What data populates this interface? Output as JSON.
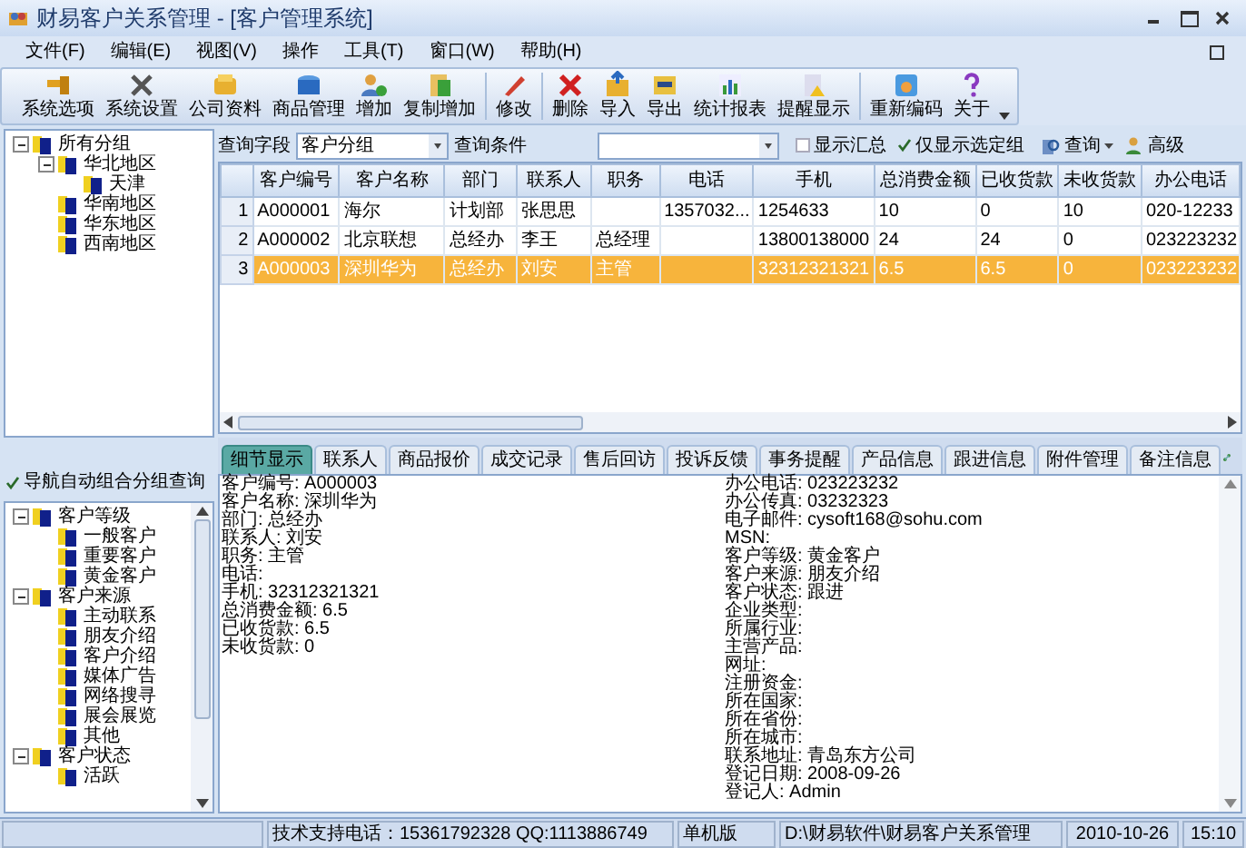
{
  "window": {
    "title": "财易客户关系管理 - [客户管理系统]"
  },
  "menu": [
    "文件(F)",
    "编辑(E)",
    "视图(V)",
    "操作",
    "工具(T)",
    "窗口(W)",
    "帮助(H)"
  ],
  "toolbar": [
    {
      "label": "系统选项"
    },
    {
      "label": "系统设置"
    },
    {
      "label": "公司资料"
    },
    {
      "label": "商品管理"
    },
    {
      "label": "增加"
    },
    {
      "label": "复制增加"
    },
    {
      "label": "修改"
    },
    {
      "label": "删除"
    },
    {
      "label": "导入"
    },
    {
      "label": "导出"
    },
    {
      "label": "统计报表"
    },
    {
      "label": "提醒显示"
    },
    {
      "label": "重新编码"
    },
    {
      "label": "关于"
    }
  ],
  "group_tree": [
    {
      "label": "所有分组",
      "expanded": true,
      "children": [
        {
          "label": "华北地区",
          "expanded": true,
          "children": [
            {
              "label": "天津"
            }
          ]
        },
        {
          "label": "华南地区"
        },
        {
          "label": "华东地区"
        },
        {
          "label": "西南地区"
        }
      ]
    }
  ],
  "nav_option": {
    "label": "导航自动组合分组查询",
    "checked": true
  },
  "nav_tree": [
    {
      "label": "客户等级",
      "expanded": true,
      "children": [
        {
          "label": "一般客户"
        },
        {
          "label": "重要客户"
        },
        {
          "label": "黄金客户"
        }
      ]
    },
    {
      "label": "客户来源",
      "expanded": true,
      "children": [
        {
          "label": "主动联系"
        },
        {
          "label": "朋友介绍"
        },
        {
          "label": "客户介绍"
        },
        {
          "label": "媒体广告"
        },
        {
          "label": "网络搜寻"
        },
        {
          "label": "展会展览"
        },
        {
          "label": "其他"
        }
      ]
    },
    {
      "label": "客户状态",
      "expanded": true,
      "children": [
        {
          "label": "活跃"
        }
      ]
    }
  ],
  "query": {
    "field_label": "查询字段",
    "field_value": "客户分组",
    "condition_label": "查询条件",
    "options": [
      {
        "label": "显示汇总",
        "checked": false
      },
      {
        "label": "仅显示选定组",
        "checked": true
      }
    ],
    "search_button": "查询",
    "advanced_button": "高级"
  },
  "table": {
    "columns": [
      "客户编号",
      "客户名称",
      "部门",
      "联系人",
      "职务",
      "电话",
      "手机",
      "总消费金额",
      "已收货款",
      "未收货款",
      "办公电话"
    ],
    "rows": [
      {
        "number": "1",
        "selected": false,
        "cells": [
          "A000001",
          "海尔",
          "计划部",
          "张思思",
          "",
          "1357032...",
          "1254633",
          "10",
          "0",
          "10",
          "020-12233"
        ]
      },
      {
        "number": "2",
        "selected": false,
        "cells": [
          "A000002",
          "北京联想",
          "总经办",
          "李王",
          "总经理",
          "",
          "13800138000",
          "24",
          "24",
          "0",
          "023223232"
        ]
      },
      {
        "number": "3",
        "selected": true,
        "cells": [
          "A000003",
          "深圳华为",
          "总经办",
          "刘安",
          "主管",
          "",
          "32312321321",
          "6.5",
          "6.5",
          "0",
          "023223232"
        ]
      }
    ]
  },
  "tabs": [
    {
      "label": "细节显示",
      "selected": true
    },
    {
      "label": "联系人",
      "selected": false
    },
    {
      "label": "商品报价",
      "selected": false
    },
    {
      "label": "成交记录",
      "selected": false
    },
    {
      "label": "售后回访",
      "selected": false
    },
    {
      "label": "投诉反馈",
      "selected": false
    },
    {
      "label": "事务提醒",
      "selected": false
    },
    {
      "label": "产品信息",
      "selected": false
    },
    {
      "label": "跟进信息",
      "selected": false
    },
    {
      "label": "附件管理",
      "selected": false
    },
    {
      "label": "备注信息",
      "selected": false
    }
  ],
  "details": {
    "left": [
      "客户编号: A000003",
      "客户名称: 深圳华为",
      "部门: 总经办",
      "联系人: 刘安",
      "职务: 主管",
      "电话:",
      "手机: 32312321321",
      "总消费金额: 6.5",
      "已收货款: 6.5",
      "未收货款: 0"
    ],
    "right": [
      "办公电话: 023223232",
      "办公传真: 03232323",
      "电子邮件: cysoft168@sohu.com",
      "MSN:",
      "客户等级: 黄金客户",
      "客户来源: 朋友介绍",
      "客户状态: 跟进",
      "企业类型:",
      "所属行业:",
      "主营产品:",
      "网址:",
      "注册资金:",
      "所在国家:",
      "所在省份:",
      "所在城市:",
      "联系地址: 青岛东方公司",
      "登记日期: 2008-09-26",
      "登记人: Admin"
    ]
  },
  "status_bar": [
    "技术支持电话：15361792328 QQ:1113886749",
    "单机版",
    "D:\\财易软件\\财易客户关系管理",
    "2010-10-26",
    "15:10"
  ]
}
